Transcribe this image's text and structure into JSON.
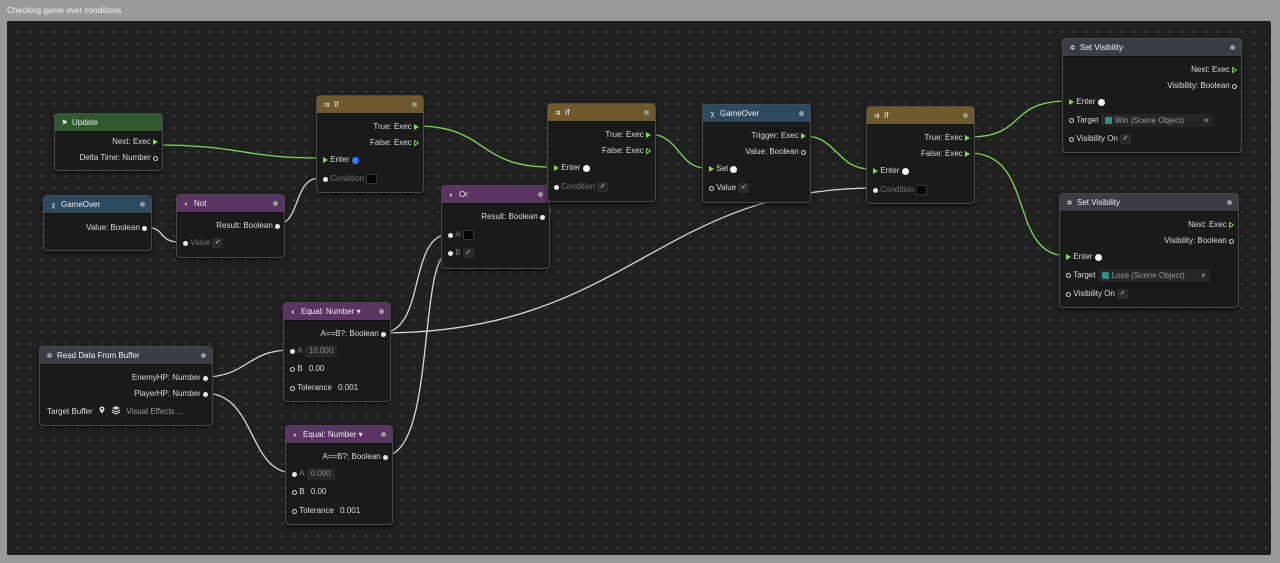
{
  "window": {
    "title": "Checking game over conditions"
  },
  "nodes": {
    "update": {
      "title": "Update",
      "icon": "flag-icon",
      "outputs": [
        "Next: Exec",
        "Delta Time: Number"
      ]
    },
    "gameover_get": {
      "title": "GameOver",
      "icon": "variable-icon",
      "output": "Value: Boolean"
    },
    "not": {
      "title": "Not",
      "icon": "operator-icon",
      "output": "Result: Boolean",
      "input": "Value"
    },
    "if1": {
      "title": "If",
      "icon": "branch-icon",
      "outputs": [
        "True: Exec",
        "False: Exec"
      ],
      "inputs": [
        "Enter",
        "Condition"
      ]
    },
    "or": {
      "title": "Or",
      "icon": "operator-icon",
      "output": "Result: Boolean",
      "inputs": [
        "A",
        "B"
      ]
    },
    "if2": {
      "title": "If",
      "icon": "branch-icon",
      "outputs": [
        "True: Exec",
        "False: Exec"
      ],
      "inputs": [
        "Enter",
        "Condition"
      ]
    },
    "gameover_set": {
      "title": "GameOver",
      "icon": "variable-icon",
      "outputs": [
        "Trigger: Exec",
        "Value: Boolean"
      ],
      "inputs": [
        "Set",
        "Value"
      ]
    },
    "if3": {
      "title": "If",
      "icon": "branch-icon",
      "outputs": [
        "True: Exec",
        "False: Exec"
      ],
      "inputs": [
        "Enter",
        "Condition"
      ]
    },
    "set_visibility_win": {
      "title": "Set Visibility",
      "icon": "gear-icon",
      "outputs": [
        "Next: Exec",
        "Visibility: Boolean"
      ],
      "enter": "Enter",
      "target_label": "Target",
      "target_value": "Win (Scene Object)",
      "visibility_label": "Visibility On"
    },
    "set_visibility_lose": {
      "title": "Set Visibility",
      "icon": "gear-icon",
      "outputs": [
        "Next: Exec",
        "Visibility: Boolean"
      ],
      "enter": "Enter",
      "target_label": "Target",
      "target_value": "Lose (Scene Object)",
      "visibility_label": "Visibility On"
    },
    "equal1": {
      "title": "Equal: Number ▾",
      "icon": "operator-icon",
      "output": "A==B?: Boolean",
      "a_label": "A",
      "a_value": "10.000",
      "b_label": "B",
      "b_value": "0.00",
      "tol_label": "Tolerance",
      "tol_value": "0.001"
    },
    "equal2": {
      "title": "Equal: Number ▾",
      "icon": "operator-icon",
      "output": "A==B?: Boolean",
      "a_label": "A",
      "a_value": "0.000",
      "b_label": "B",
      "b_value": "0.00",
      "tol_label": "Tolerance",
      "tol_value": "0.001"
    },
    "read_buffer": {
      "title": "Read Data From Buffer",
      "icon": "gear-icon",
      "outputs": [
        "EnemyHP: Number",
        "PlayerHP: Number"
      ],
      "target_label": "Target Buffer",
      "target_value": "Visual Effects ..."
    }
  },
  "colors": {
    "exec_wire": "#7ed957",
    "data_wire": "#d9d9d9",
    "event": "#2f5a2d",
    "flow": "#6e5a2c",
    "variable": "#2d4a5e",
    "operator": "#5a3462",
    "action": "#3a3e44"
  }
}
